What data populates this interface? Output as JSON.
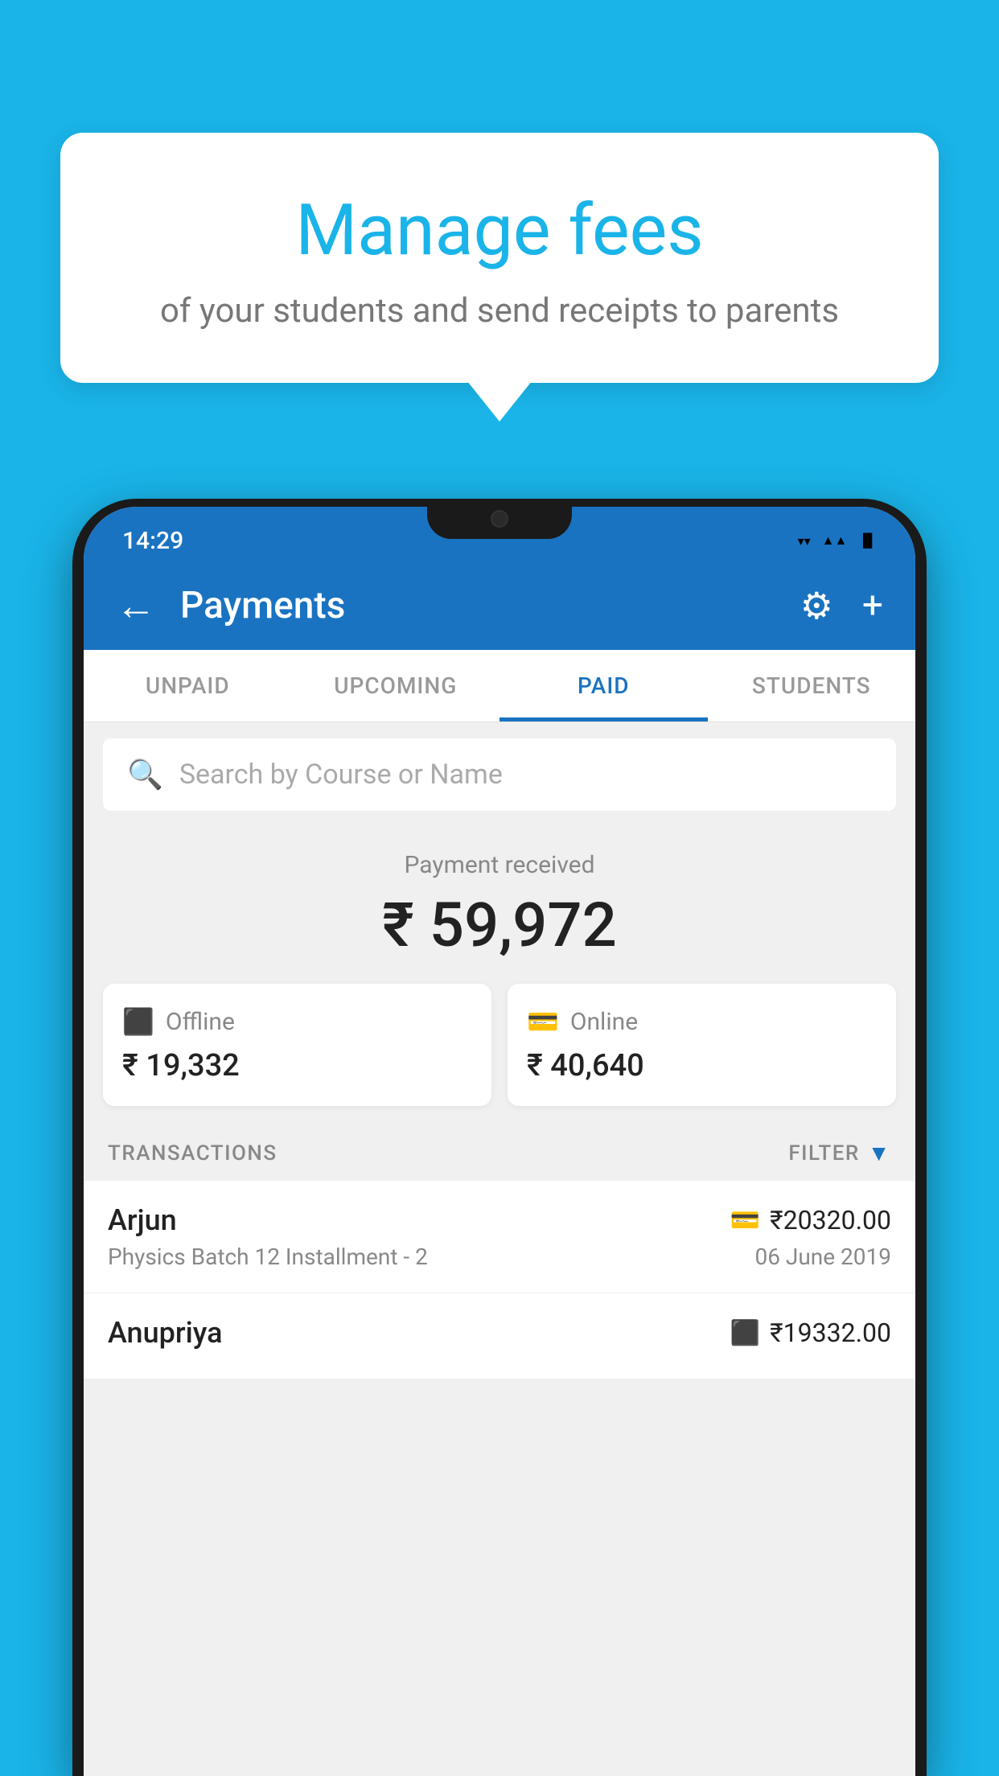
{
  "background_color": "#1ab4e8",
  "bubble": {
    "title": "Manage fees",
    "subtitle": "of your students and send receipts to parents"
  },
  "status_bar": {
    "time": "14:29",
    "wifi": "▼",
    "signal": "▲",
    "battery": "▐"
  },
  "app_bar": {
    "title": "Payments",
    "back_icon": "←",
    "gear_icon": "⚙",
    "plus_icon": "+"
  },
  "tabs": [
    {
      "label": "UNPAID",
      "active": false
    },
    {
      "label": "UPCOMING",
      "active": false
    },
    {
      "label": "PAID",
      "active": true
    },
    {
      "label": "STUDENTS",
      "active": false
    }
  ],
  "search": {
    "placeholder": "Search by Course or Name"
  },
  "payment_summary": {
    "label": "Payment received",
    "amount": "₹ 59,972",
    "offline": {
      "label": "Offline",
      "amount": "₹ 19,332"
    },
    "online": {
      "label": "Online",
      "amount": "₹ 40,640"
    }
  },
  "transactions": {
    "header": "TRANSACTIONS",
    "filter": "FILTER",
    "rows": [
      {
        "name": "Arjun",
        "course": "Physics Batch 12 Installment - 2",
        "amount": "₹20320.00",
        "date": "06 June 2019",
        "payment_type": "card"
      },
      {
        "name": "Anupriya",
        "amount": "₹19332.00",
        "payment_type": "offline"
      }
    ]
  }
}
